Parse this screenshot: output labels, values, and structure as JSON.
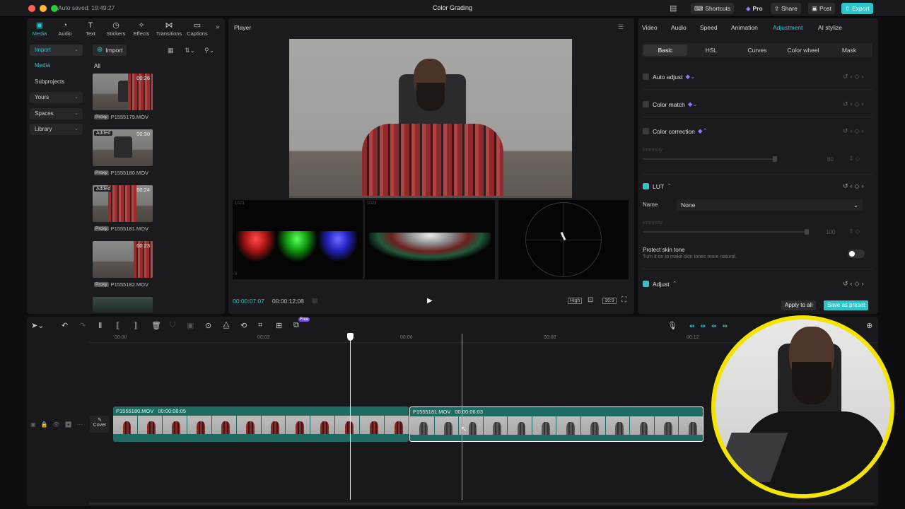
{
  "titlebar": {
    "autosave": "Auto saved: 19:49:27",
    "title": "Color Grading",
    "shortcuts": "Shortcuts",
    "pro": "Pro",
    "share": "Share",
    "post": "Post",
    "export": "Export"
  },
  "media_tabs": [
    {
      "label": "Media",
      "icon": "media-icon"
    },
    {
      "label": "Audio",
      "icon": "audio-icon"
    },
    {
      "label": "Text",
      "icon": "text-icon"
    },
    {
      "label": "Stickers",
      "icon": "stickers-icon"
    },
    {
      "label": "Effects",
      "icon": "effects-icon"
    },
    {
      "label": "Transitions",
      "icon": "transitions-icon"
    },
    {
      "label": "Captions",
      "icon": "captions-icon"
    }
  ],
  "sidebar": {
    "items": [
      "Import",
      "Media",
      "Subprojects",
      "Yours",
      "Spaces",
      "Library"
    ]
  },
  "media": {
    "import_label": "Import",
    "filter": "All",
    "files": [
      {
        "name": "P1555179.MOV",
        "duration": "00:26",
        "added": "",
        "proxy": "Proxy"
      },
      {
        "name": "P1555180.MOV",
        "duration": "00:30",
        "added": "Added",
        "proxy": "Proxy"
      },
      {
        "name": "P1555181.MOV",
        "duration": "00:24",
        "added": "Added",
        "proxy": "Proxy"
      },
      {
        "name": "P1555182.MOV",
        "duration": "00:23",
        "added": "",
        "proxy": "Proxy"
      }
    ]
  },
  "player": {
    "title": "Player",
    "current_time": "00:00:07:07",
    "total_time": "00:00:12:08",
    "quality": "High",
    "ratio": "16:9",
    "scope_label_1": "1023",
    "scope_label_2": "1023",
    "scope_zero": "0"
  },
  "inspector": {
    "tabs": [
      "Video",
      "Audio",
      "Speed",
      "Animation",
      "Adjustment",
      "AI stylize"
    ],
    "active_tab": "Adjustment",
    "subtabs": [
      "Basic",
      "HSL",
      "Curves",
      "Color wheel",
      "Mask"
    ],
    "auto_adjust": "Auto adjust",
    "color_match": "Color match",
    "color_correction": "Color correction",
    "intensity_label": "Intensity",
    "intensity_value": "80",
    "lut": "LUT",
    "name_label": "Name",
    "lut_name": "None",
    "lut_intensity_label": "Intensity",
    "lut_intensity_value": "100",
    "protect_skin": "Protect skin tone",
    "protect_skin_desc": "Turn it on to make skin tones more natural.",
    "adjust": "Adjust",
    "apply_all": "Apply to all",
    "save_preset": "Save as preset",
    "accent": "#2ec5c9"
  },
  "timeline": {
    "ticks": [
      "00:00",
      "00:03",
      "00:06",
      "00:09",
      "00:12"
    ],
    "free_badge": "Free",
    "cover_label": "Cover",
    "clips": [
      {
        "name": "P1555180.MOV",
        "duration": "00:00:06:05"
      },
      {
        "name": "P1555181.MOV",
        "duration": "00:00:06:03"
      }
    ]
  }
}
